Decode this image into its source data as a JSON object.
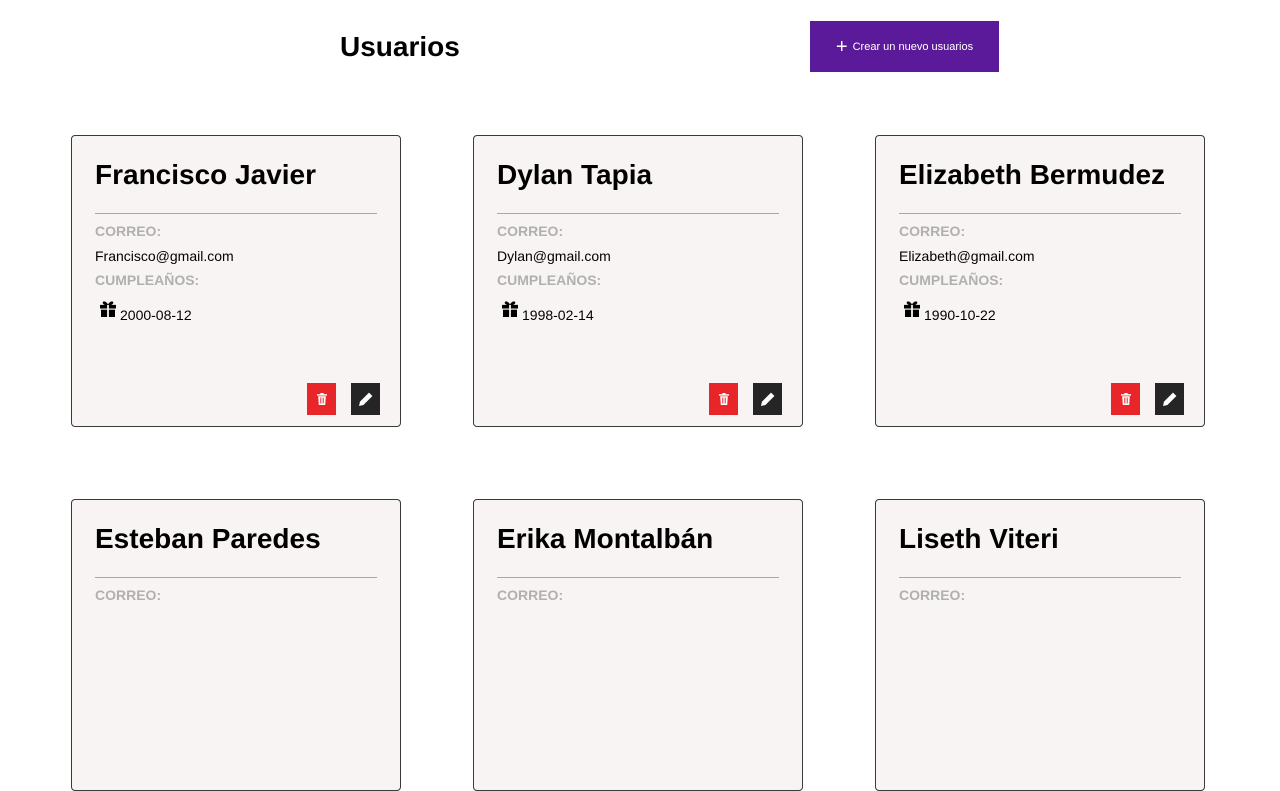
{
  "header": {
    "title": "Usuarios",
    "create_button_label": "Crear un nuevo usuarios"
  },
  "labels": {
    "email": "CORREO:",
    "birthday": "CUMPLEAÑOS:"
  },
  "users": [
    {
      "name": "Francisco Javier",
      "email": "Francisco@gmail.com",
      "birthday": "2000-08-12"
    },
    {
      "name": "Dylan Tapia",
      "email": "Dylan@gmail.com",
      "birthday": "1998-02-14"
    },
    {
      "name": "Elizabeth Bermudez",
      "email": "Elizabeth@gmail.com",
      "birthday": "1990-10-22"
    },
    {
      "name": "Esteban Paredes"
    },
    {
      "name": "Erika Montalbán"
    },
    {
      "name": "Liseth Viteri"
    }
  ],
  "icons": {
    "create": "plus-icon",
    "birthday": "gift-icon",
    "delete": "trash-icon",
    "edit": "pencil-icon"
  },
  "colors": {
    "primary": "#5b1a99",
    "delete": "#e8262a",
    "edit": "#252525",
    "card_background": "#f8f4f3",
    "label": "#b0b0b0"
  }
}
